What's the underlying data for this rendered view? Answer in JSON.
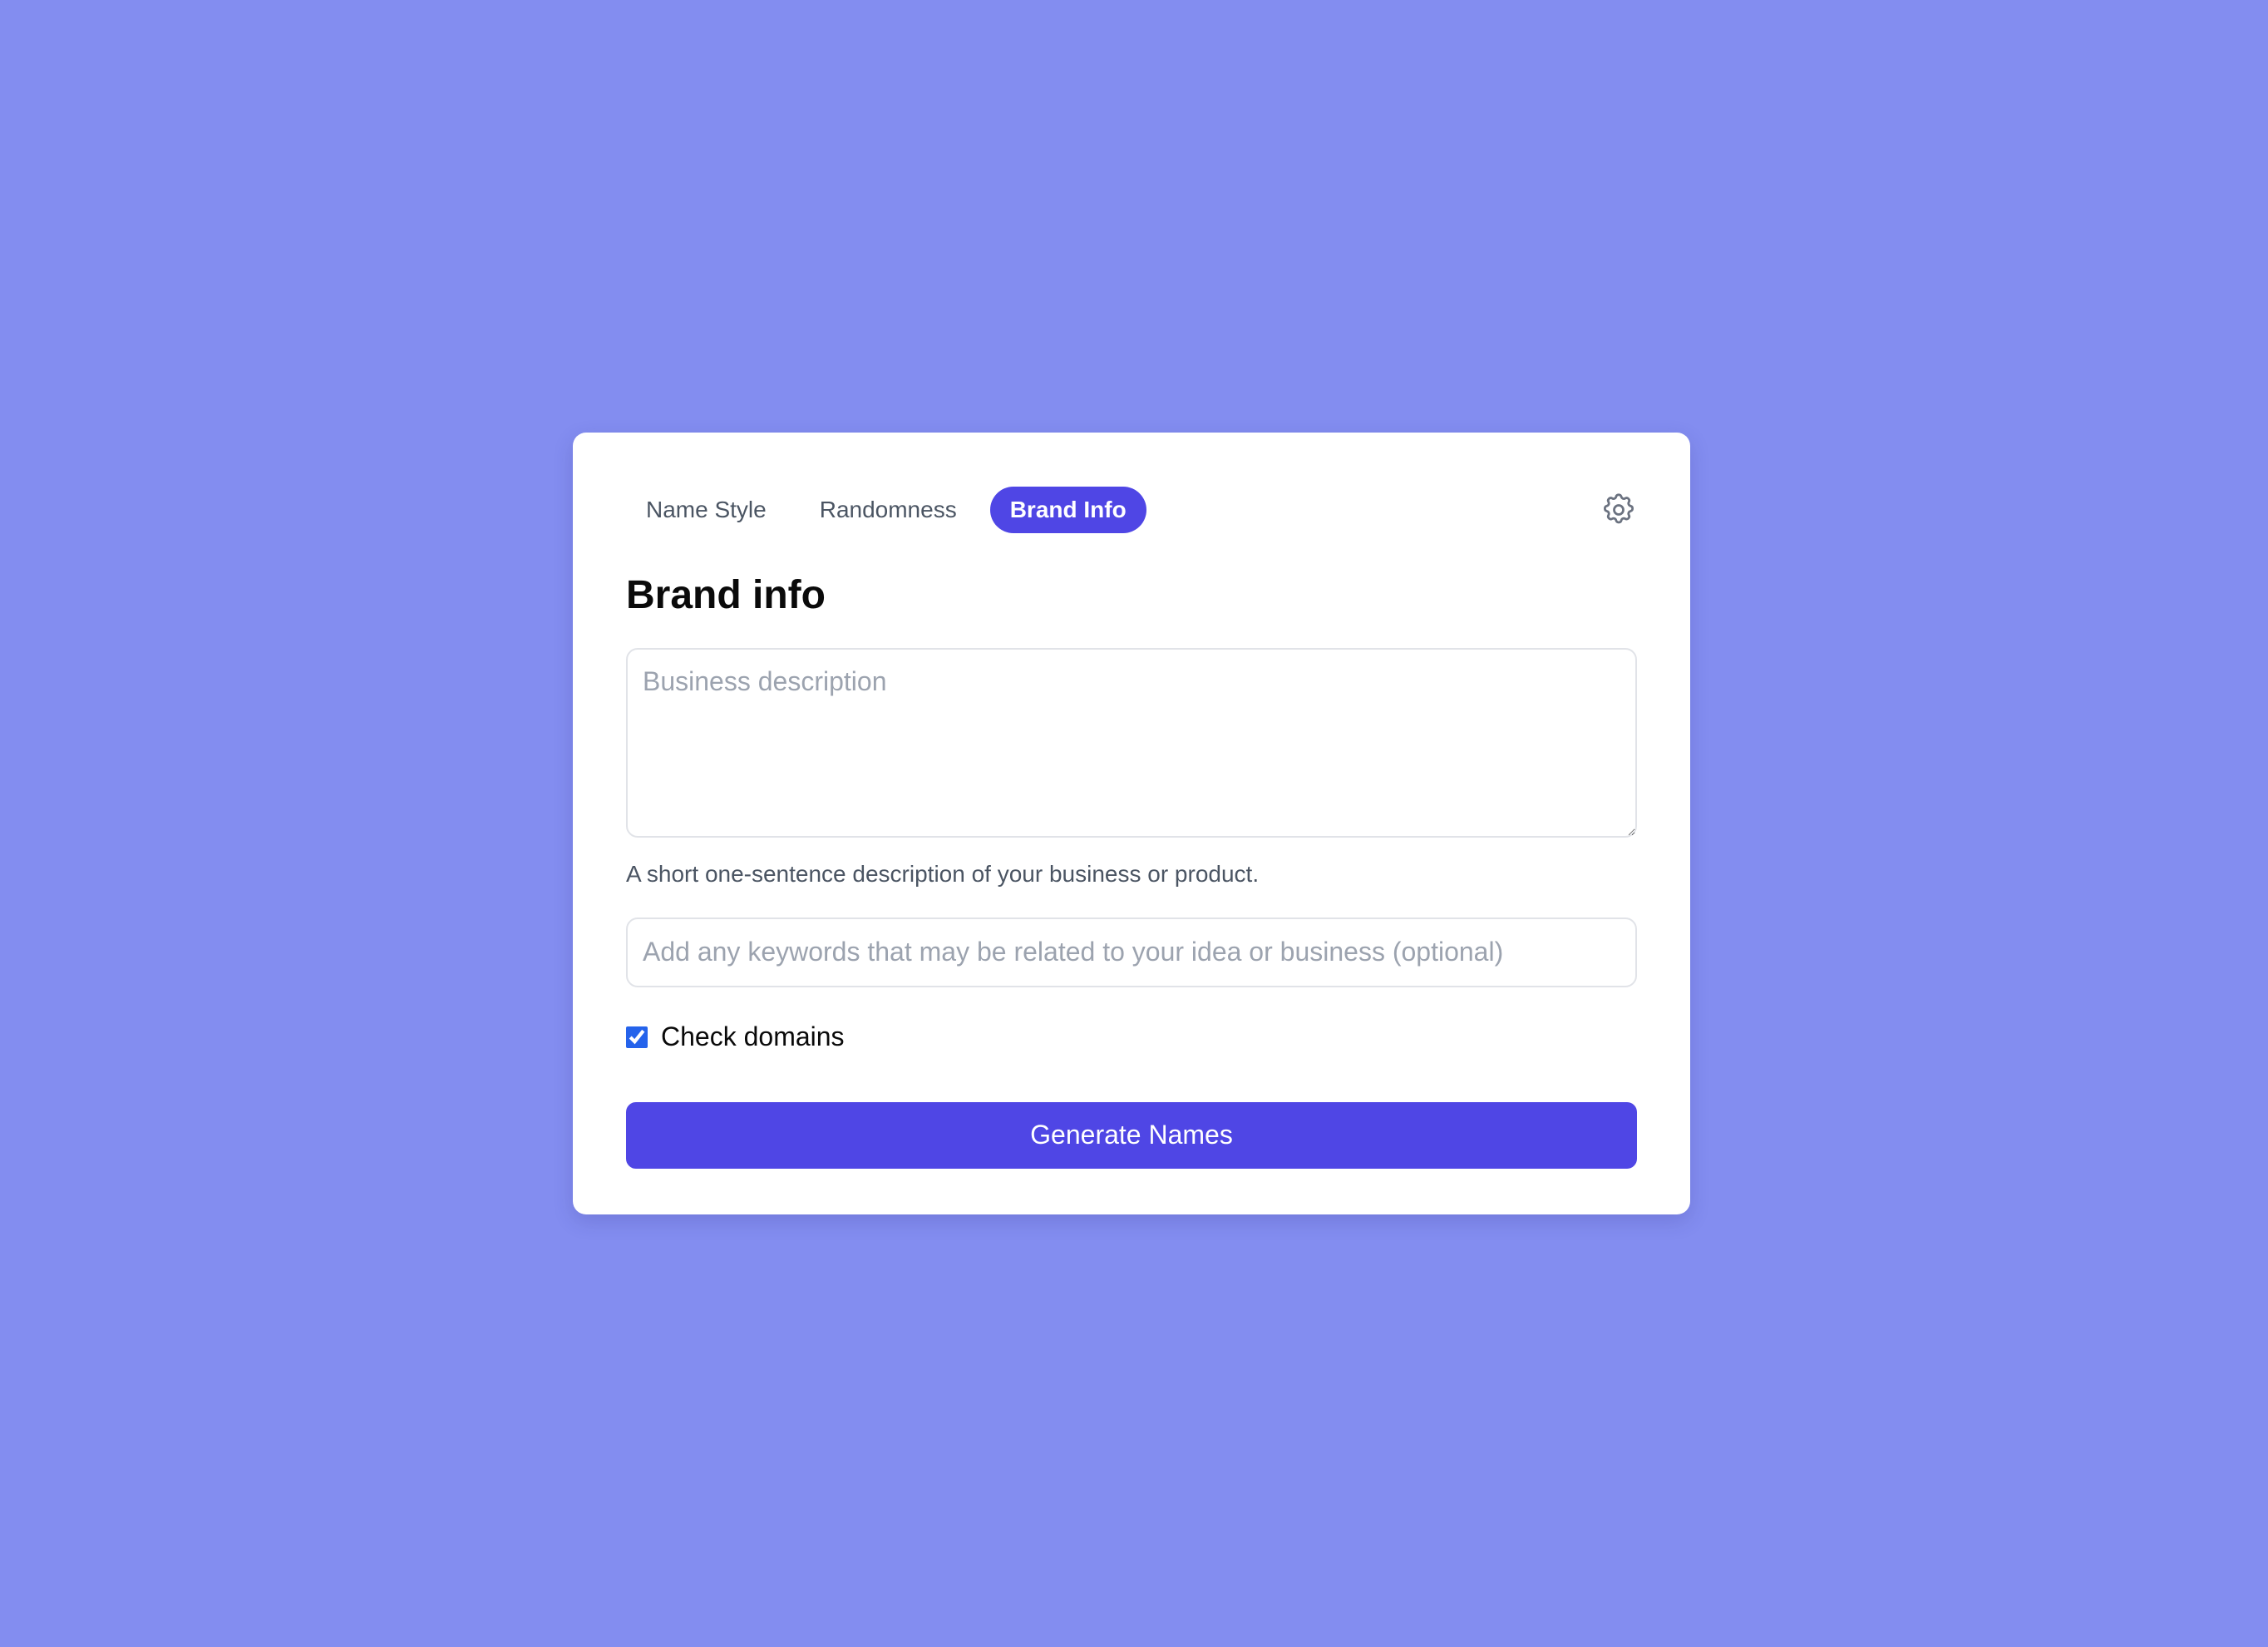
{
  "theme": {
    "background": "#838df0",
    "accent": "#4f46e5",
    "card_background": "#ffffff",
    "checkbox_color": "#2563eb"
  },
  "tabs": [
    {
      "label": "Name Style",
      "active": false
    },
    {
      "label": "Randomness",
      "active": false
    },
    {
      "label": "Brand Info",
      "active": true
    }
  ],
  "settings": {
    "icon": "gear-icon"
  },
  "section": {
    "title": "Brand info",
    "description_placeholder": "Business description",
    "description_value": "",
    "description_help": "A short one-sentence description of your business or product.",
    "keywords_placeholder": "Add any keywords that may be related to your idea or business (optional)",
    "keywords_value": "",
    "check_domains_label": "Check domains",
    "check_domains_checked": true,
    "generate_label": "Generate Names"
  }
}
